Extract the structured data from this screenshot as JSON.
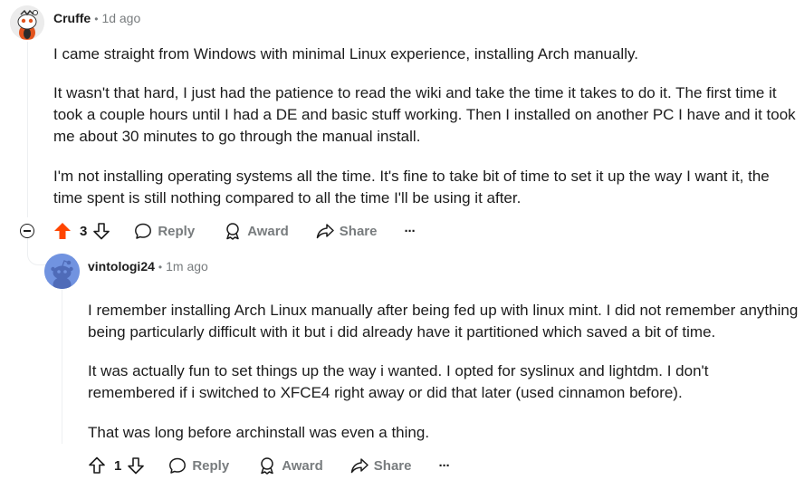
{
  "comments": [
    {
      "author": "Cruffe",
      "separator": "•",
      "time": "1d ago",
      "paragraphs": [
        "I came straight from Windows with minimal Linux experience, installing Arch manually.",
        "It wasn't that hard, I just had the patience to read the wiki and take the time it takes to do it. The first time it took a couple hours until I had a DE and basic stuff working. Then I installed on another PC I have and it took me about 30 minutes to go through the manual install.",
        "I'm not installing operating systems all the time. It's fine to take bit of time to set it up the way I want it, the time spent is still nothing compared to all the time I'll be using it after."
      ],
      "score": "3",
      "upvoted": true,
      "reply_label": "Reply",
      "award_label": "Award",
      "share_label": "Share",
      "more_label": "···"
    },
    {
      "author": "vintologi24",
      "separator": "•",
      "time": "1m ago",
      "paragraphs": [
        "I remember installing Arch Linux manually after being fed up with linux mint. I did not remember anything being particularly difficult with it but i did already have it partitioned which saved a bit of time.",
        "It was actually fun to set things up the way i wanted. I opted for syslinux and lightdm. I don't remembered if i switched to XFCE4 right away or did that later (used cinnamon before).",
        "That was long before archinstall was even a thing."
      ],
      "score": "1",
      "upvoted": false,
      "reply_label": "Reply",
      "award_label": "Award",
      "share_label": "Share",
      "more_label": "···"
    }
  ],
  "colors": {
    "upvote_active": "#ff4500",
    "muted": "#787c7e",
    "text": "#1c1c1c",
    "thread_line": "#edeff1",
    "avatar_blue": "#6f8fdc"
  },
  "icons": [
    "collapse-icon",
    "upvote-icon",
    "downvote-icon",
    "reply-icon",
    "award-icon",
    "share-icon",
    "more-icon"
  ]
}
